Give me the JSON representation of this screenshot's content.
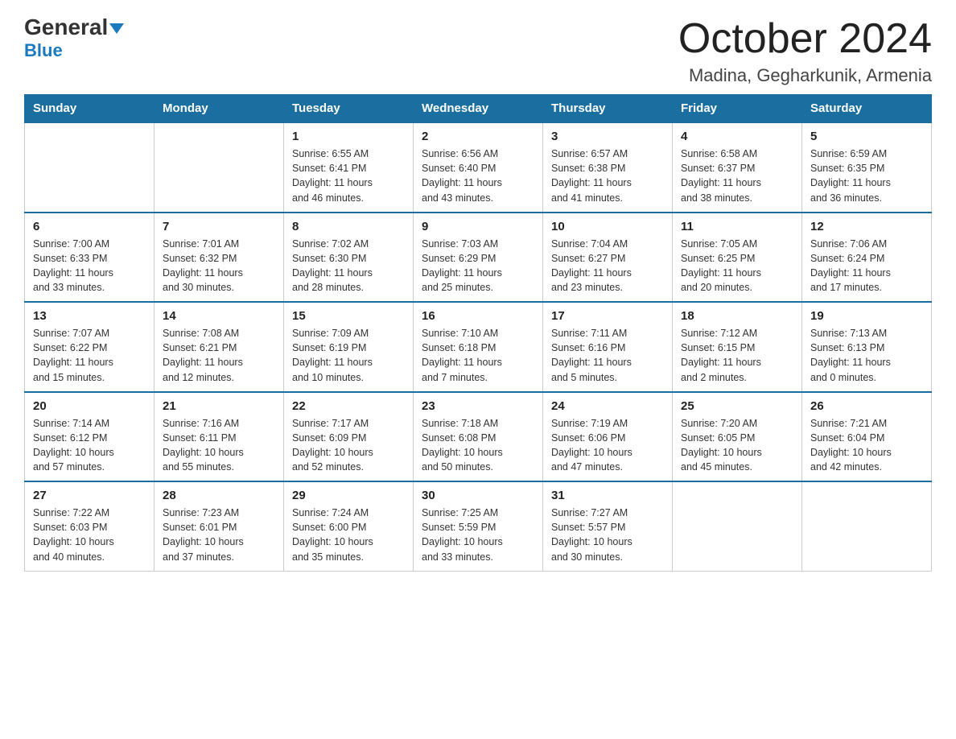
{
  "logo": {
    "line1_black": "General",
    "line1_blue_arrow": "▶",
    "line2": "Blue"
  },
  "title": "October 2024",
  "subtitle": "Madina, Gegharkunik, Armenia",
  "days_of_week": [
    "Sunday",
    "Monday",
    "Tuesday",
    "Wednesday",
    "Thursday",
    "Friday",
    "Saturday"
  ],
  "weeks": [
    [
      {
        "day": "",
        "info": ""
      },
      {
        "day": "",
        "info": ""
      },
      {
        "day": "1",
        "info": "Sunrise: 6:55 AM\nSunset: 6:41 PM\nDaylight: 11 hours\nand 46 minutes."
      },
      {
        "day": "2",
        "info": "Sunrise: 6:56 AM\nSunset: 6:40 PM\nDaylight: 11 hours\nand 43 minutes."
      },
      {
        "day": "3",
        "info": "Sunrise: 6:57 AM\nSunset: 6:38 PM\nDaylight: 11 hours\nand 41 minutes."
      },
      {
        "day": "4",
        "info": "Sunrise: 6:58 AM\nSunset: 6:37 PM\nDaylight: 11 hours\nand 38 minutes."
      },
      {
        "day": "5",
        "info": "Sunrise: 6:59 AM\nSunset: 6:35 PM\nDaylight: 11 hours\nand 36 minutes."
      }
    ],
    [
      {
        "day": "6",
        "info": "Sunrise: 7:00 AM\nSunset: 6:33 PM\nDaylight: 11 hours\nand 33 minutes."
      },
      {
        "day": "7",
        "info": "Sunrise: 7:01 AM\nSunset: 6:32 PM\nDaylight: 11 hours\nand 30 minutes."
      },
      {
        "day": "8",
        "info": "Sunrise: 7:02 AM\nSunset: 6:30 PM\nDaylight: 11 hours\nand 28 minutes."
      },
      {
        "day": "9",
        "info": "Sunrise: 7:03 AM\nSunset: 6:29 PM\nDaylight: 11 hours\nand 25 minutes."
      },
      {
        "day": "10",
        "info": "Sunrise: 7:04 AM\nSunset: 6:27 PM\nDaylight: 11 hours\nand 23 minutes."
      },
      {
        "day": "11",
        "info": "Sunrise: 7:05 AM\nSunset: 6:25 PM\nDaylight: 11 hours\nand 20 minutes."
      },
      {
        "day": "12",
        "info": "Sunrise: 7:06 AM\nSunset: 6:24 PM\nDaylight: 11 hours\nand 17 minutes."
      }
    ],
    [
      {
        "day": "13",
        "info": "Sunrise: 7:07 AM\nSunset: 6:22 PM\nDaylight: 11 hours\nand 15 minutes."
      },
      {
        "day": "14",
        "info": "Sunrise: 7:08 AM\nSunset: 6:21 PM\nDaylight: 11 hours\nand 12 minutes."
      },
      {
        "day": "15",
        "info": "Sunrise: 7:09 AM\nSunset: 6:19 PM\nDaylight: 11 hours\nand 10 minutes."
      },
      {
        "day": "16",
        "info": "Sunrise: 7:10 AM\nSunset: 6:18 PM\nDaylight: 11 hours\nand 7 minutes."
      },
      {
        "day": "17",
        "info": "Sunrise: 7:11 AM\nSunset: 6:16 PM\nDaylight: 11 hours\nand 5 minutes."
      },
      {
        "day": "18",
        "info": "Sunrise: 7:12 AM\nSunset: 6:15 PM\nDaylight: 11 hours\nand 2 minutes."
      },
      {
        "day": "19",
        "info": "Sunrise: 7:13 AM\nSunset: 6:13 PM\nDaylight: 11 hours\nand 0 minutes."
      }
    ],
    [
      {
        "day": "20",
        "info": "Sunrise: 7:14 AM\nSunset: 6:12 PM\nDaylight: 10 hours\nand 57 minutes."
      },
      {
        "day": "21",
        "info": "Sunrise: 7:16 AM\nSunset: 6:11 PM\nDaylight: 10 hours\nand 55 minutes."
      },
      {
        "day": "22",
        "info": "Sunrise: 7:17 AM\nSunset: 6:09 PM\nDaylight: 10 hours\nand 52 minutes."
      },
      {
        "day": "23",
        "info": "Sunrise: 7:18 AM\nSunset: 6:08 PM\nDaylight: 10 hours\nand 50 minutes."
      },
      {
        "day": "24",
        "info": "Sunrise: 7:19 AM\nSunset: 6:06 PM\nDaylight: 10 hours\nand 47 minutes."
      },
      {
        "day": "25",
        "info": "Sunrise: 7:20 AM\nSunset: 6:05 PM\nDaylight: 10 hours\nand 45 minutes."
      },
      {
        "day": "26",
        "info": "Sunrise: 7:21 AM\nSunset: 6:04 PM\nDaylight: 10 hours\nand 42 minutes."
      }
    ],
    [
      {
        "day": "27",
        "info": "Sunrise: 7:22 AM\nSunset: 6:03 PM\nDaylight: 10 hours\nand 40 minutes."
      },
      {
        "day": "28",
        "info": "Sunrise: 7:23 AM\nSunset: 6:01 PM\nDaylight: 10 hours\nand 37 minutes."
      },
      {
        "day": "29",
        "info": "Sunrise: 7:24 AM\nSunset: 6:00 PM\nDaylight: 10 hours\nand 35 minutes."
      },
      {
        "day": "30",
        "info": "Sunrise: 7:25 AM\nSunset: 5:59 PM\nDaylight: 10 hours\nand 33 minutes."
      },
      {
        "day": "31",
        "info": "Sunrise: 7:27 AM\nSunset: 5:57 PM\nDaylight: 10 hours\nand 30 minutes."
      },
      {
        "day": "",
        "info": ""
      },
      {
        "day": "",
        "info": ""
      }
    ]
  ]
}
